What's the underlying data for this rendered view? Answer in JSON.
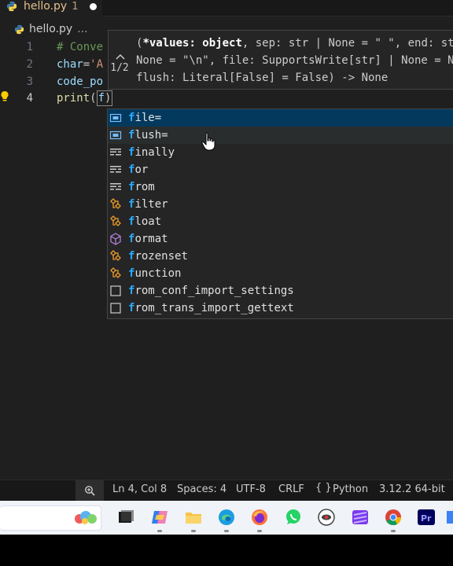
{
  "tab": {
    "filename": "hello.py",
    "modified_count": "1"
  },
  "breadcrumb": {
    "file": "hello.py",
    "ellipsis": "..."
  },
  "code_lines": [
    {
      "num": "1",
      "text": "# Conve"
    },
    {
      "num": "2",
      "text_var": "char",
      "text_op": "=",
      "text_str": "'A"
    },
    {
      "num": "3",
      "text": "code_po"
    },
    {
      "num": "4",
      "text_fn": "print",
      "text_paren": "(",
      "text_arg": "f",
      "text_close": ")"
    }
  ],
  "signature_help": {
    "counter": "1/2",
    "line1_pre": "(",
    "line1_bold": "*values: object",
    "line1_post": ", sep: str | None = \" \", end: str |",
    "line2": "None = \"\\n\", file: SupportsWrite[str] | None = N",
    "line3": "flush: Literal[False] = False) -> None"
  },
  "suggestions": [
    {
      "match": "f",
      "rest": "ile=",
      "kind": "variable"
    },
    {
      "match": "f",
      "rest": "lush=",
      "kind": "variable"
    },
    {
      "match": "f",
      "rest": "inally",
      "kind": "keyword"
    },
    {
      "match": "f",
      "rest": "or",
      "kind": "keyword"
    },
    {
      "match": "f",
      "rest": "rom",
      "kind": "keyword"
    },
    {
      "match": "f",
      "rest": "ilter",
      "kind": "class"
    },
    {
      "match": "f",
      "rest": "loat",
      "kind": "class"
    },
    {
      "match": "f",
      "rest": "ormat",
      "kind": "method"
    },
    {
      "match": "f",
      "rest": "rozenset",
      "kind": "class"
    },
    {
      "match": "f",
      "rest": "unction",
      "kind": "class"
    },
    {
      "match": "f",
      "rest": "rom_conf_import_settings",
      "kind": "text"
    },
    {
      "match": "f",
      "rest": "rom_trans_import_gettext",
      "kind": "text"
    }
  ],
  "status_bar": {
    "position": "Ln 4, Col 8",
    "spaces": "Spaces: 4",
    "encoding": "UTF-8",
    "eol": "CRLF",
    "language_icon": "{ }",
    "language": "Python",
    "interpreter": "3.12.2 64-bit"
  },
  "colors": {
    "accent": "#0078d4",
    "selection": "#04395e",
    "match": "#2aaaff"
  }
}
